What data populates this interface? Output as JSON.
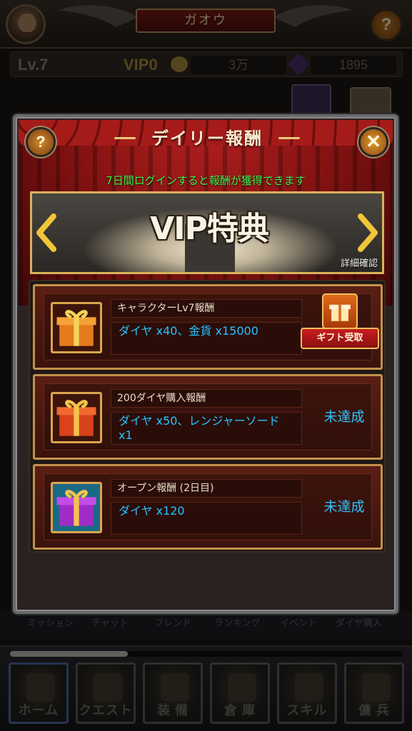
{
  "header": {
    "player_name": "ガオウ",
    "help_icon": "question-mark-icon"
  },
  "stats": {
    "level": "Lv.7",
    "vip": "VIP0",
    "gold": "3万",
    "gems": "1895"
  },
  "menu": {
    "items": [
      "ミッション",
      "チャット",
      "フレンド",
      "ランキング",
      "イベント",
      "ダイヤ購入"
    ]
  },
  "bottom_nav": {
    "items": [
      {
        "label": "ホーム",
        "icon": "home-icon"
      },
      {
        "label": "クエスト",
        "icon": "crossed-swords-icon"
      },
      {
        "label": "装 備",
        "icon": "armor-icon"
      },
      {
        "label": "倉 庫",
        "icon": "treasure-chest-icon"
      },
      {
        "label": "スキル",
        "icon": "spellbook-icon"
      },
      {
        "label": "傭 兵",
        "icon": "mercenary-icon"
      }
    ],
    "active_index": 0,
    "xp_fraction": 0.3
  },
  "dialog": {
    "title": "デイリー報酬",
    "login_hint": "7日間ログインすると報酬が獲得できます",
    "banner": {
      "title": "VIP特典",
      "detail_link": "詳細確認"
    },
    "rewards": [
      {
        "name": "キャラクターLv7報酬",
        "items": "ダイヤ x40、金貨 x15000",
        "status": "",
        "claim_label": "ギフト受取",
        "icon_color": "#e67a1e"
      },
      {
        "name": "200ダイヤ購入報酬",
        "items": "ダイヤ x50、レンジャーソード x1",
        "status": "未達成",
        "claim_label": "",
        "icon_color": "#d9431c"
      },
      {
        "name": "オープン報酬 (2日目)",
        "items": "ダイヤ x120",
        "status": "未達成",
        "claim_label": "",
        "icon_color": "#a02cc8"
      }
    ]
  },
  "colors": {
    "accent_gold": "#d8b25a",
    "hint_green": "#3ef04a",
    "status_blue": "#2ec2ff",
    "curtain_red": "#b3201f"
  }
}
